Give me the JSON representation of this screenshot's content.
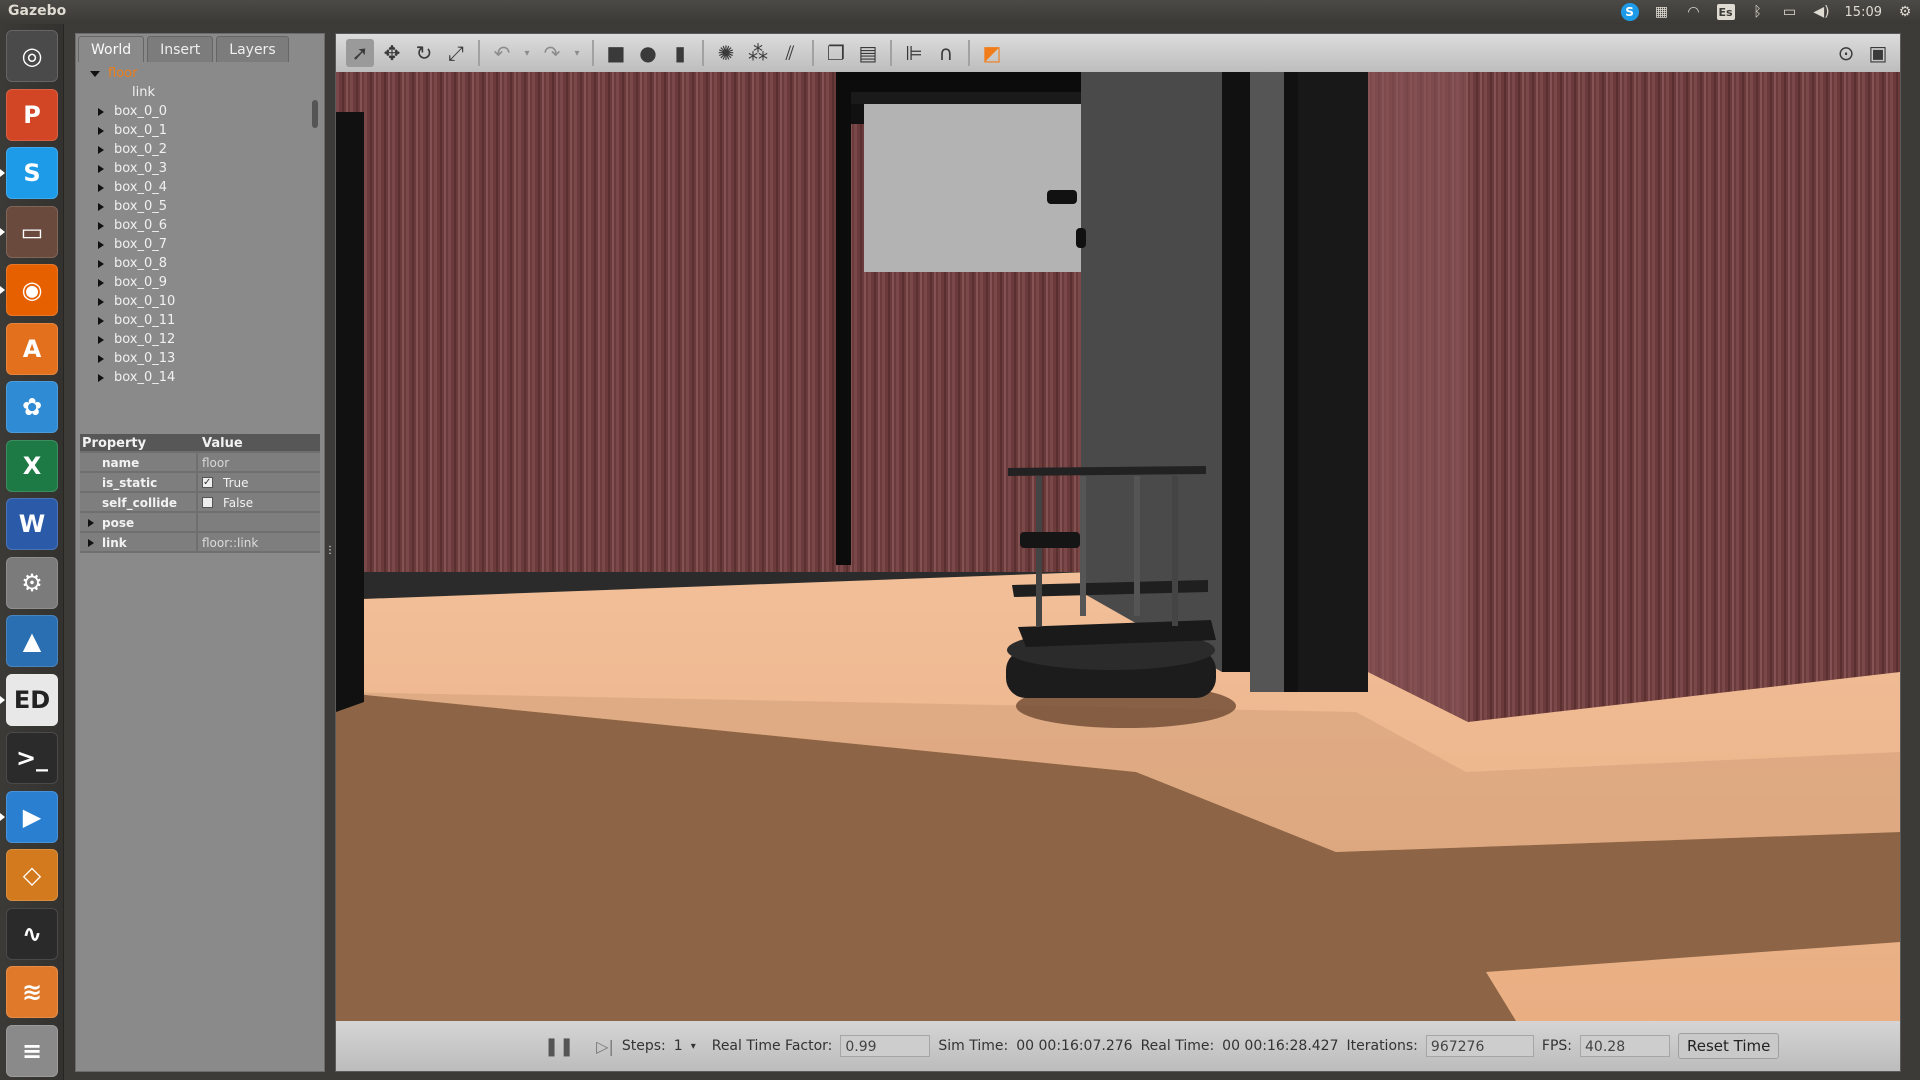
{
  "window": {
    "title": "Gazebo",
    "clock": "15:09",
    "keyboard": "Es"
  },
  "launcher": {
    "items": [
      {
        "name": "system-settings-icon",
        "color": "#4a4a4a",
        "glyph": "◎"
      },
      {
        "name": "powerpoint-icon",
        "color": "#d24625",
        "glyph": "P"
      },
      {
        "name": "skype-icon",
        "color": "#1e9be8",
        "glyph": "S"
      },
      {
        "name": "files-icon",
        "color": "#6a4a3c",
        "glyph": "▭"
      },
      {
        "name": "firefox-icon",
        "color": "#e66000",
        "glyph": "◉"
      },
      {
        "name": "software-center-icon",
        "color": "#e2701c",
        "glyph": "A"
      },
      {
        "name": "picasa-icon",
        "color": "#2e8bd4",
        "glyph": "✿"
      },
      {
        "name": "excel-icon",
        "color": "#1d7a45",
        "glyph": "X"
      },
      {
        "name": "word-icon",
        "color": "#2b5ba8",
        "glyph": "W"
      },
      {
        "name": "tools-icon",
        "color": "#7b7b7b",
        "glyph": "⚙"
      },
      {
        "name": "matlab-icon",
        "color": "#2a6fb2",
        "glyph": "▲"
      },
      {
        "name": "fred-icon",
        "color": "#e8e8e8",
        "glyph": "ED"
      },
      {
        "name": "terminal-icon",
        "color": "#2b2b2b",
        "glyph": ">_"
      },
      {
        "name": "media-player-icon",
        "color": "#2a7fd0",
        "glyph": "▶"
      },
      {
        "name": "gazebo-icon",
        "color": "#d37a1e",
        "glyph": "◇"
      },
      {
        "name": "system-monitor-icon",
        "color": "#2a2a2a",
        "glyph": "∿"
      },
      {
        "name": "stacked-apps-icon",
        "color": "#e07a2a",
        "glyph": "≋"
      },
      {
        "name": "trash-icon",
        "color": "#8a8a8a",
        "glyph": "≡"
      }
    ]
  },
  "tabs": [
    "World",
    "Insert",
    "Layers"
  ],
  "tree": {
    "root": "floor",
    "root_child": "link",
    "items": [
      "box_0_0",
      "box_0_1",
      "box_0_2",
      "box_0_3",
      "box_0_4",
      "box_0_5",
      "box_0_6",
      "box_0_7",
      "box_0_8",
      "box_0_9",
      "box_0_10",
      "box_0_11",
      "box_0_12",
      "box_0_13",
      "box_0_14"
    ]
  },
  "properties": {
    "header_property": "Property",
    "header_value": "Value",
    "name_key": "name",
    "name_val": "floor",
    "is_static_key": "is_static",
    "is_static_val": "True",
    "self_collide_key": "self_collide",
    "self_collide_val": "False",
    "pose_key": "pose",
    "link_key": "link",
    "link_val": "floor::link"
  },
  "bottombar": {
    "steps_label": "Steps:",
    "steps_val": "1",
    "rtf_label": "Real Time Factor:",
    "rtf_val": "0.99",
    "sim_label": "Sim Time:",
    "sim_val": "00 00:16:07.276",
    "real_label": "Real Time:",
    "real_val": "00 00:16:28.427",
    "iter_label": "Iterations:",
    "iter_val": "967276",
    "fps_label": "FPS:",
    "fps_val": "40.28",
    "reset_label": "Reset Time"
  },
  "colors": {
    "accent": "#f07d1a",
    "panel": "#8a8a8a",
    "toolbar": "#cfcfcf"
  }
}
